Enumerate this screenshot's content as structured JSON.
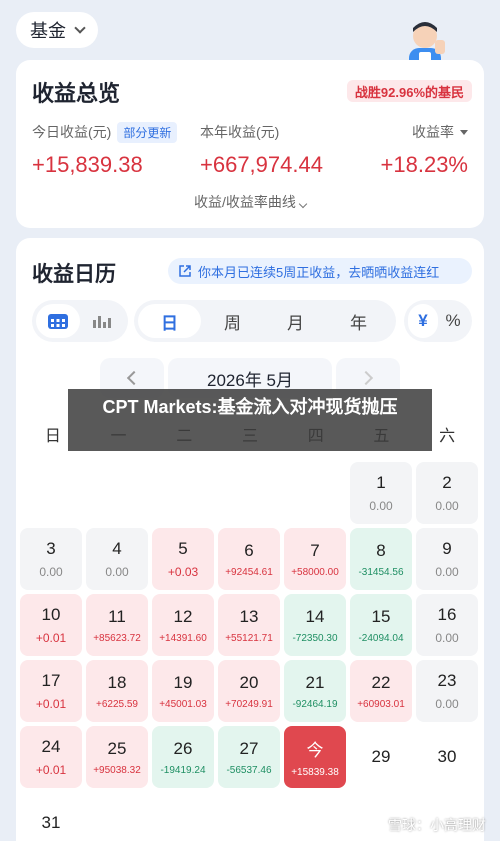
{
  "fund_selector": {
    "label": "基金"
  },
  "overview": {
    "title": "收益总览",
    "win_rate": "战胜92.96%的基民",
    "today": {
      "label": "今日收益(元)",
      "tag": "部分更新",
      "value": "+15,839.38"
    },
    "year": {
      "label": "本年收益(元)",
      "value": "+667,974.44"
    },
    "rate": {
      "label": "收益率",
      "value": "+18.23%"
    },
    "curve_link": "收益/收益率曲线"
  },
  "calendar": {
    "title": "收益日历",
    "streak_banner": "你本月已连续5周正收益，去晒晒收益连红",
    "period_tabs": [
      "日",
      "周",
      "月",
      "年"
    ],
    "unit_tabs": [
      "¥",
      "%"
    ],
    "month": "2026年 5月",
    "weekdays": [
      "日",
      "一",
      "二",
      "三",
      "四",
      "五",
      "六"
    ],
    "days": [
      {
        "d": "1",
        "v": "0.00"
      },
      {
        "d": "2",
        "v": "0.00"
      },
      {
        "d": "3",
        "v": "0.00"
      },
      {
        "d": "4",
        "v": "0.00"
      },
      {
        "d": "5",
        "v": "+0.03"
      },
      {
        "d": "6",
        "v": "+92454.61"
      },
      {
        "d": "7",
        "v": "+58000.00"
      },
      {
        "d": "8",
        "v": "-31454.56"
      },
      {
        "d": "9",
        "v": "0.00"
      },
      {
        "d": "10",
        "v": "+0.01"
      },
      {
        "d": "11",
        "v": "+85623.72"
      },
      {
        "d": "12",
        "v": "+14391.60"
      },
      {
        "d": "13",
        "v": "+55121.71"
      },
      {
        "d": "14",
        "v": "-72350.30"
      },
      {
        "d": "15",
        "v": "-24094.04"
      },
      {
        "d": "16",
        "v": "0.00"
      },
      {
        "d": "17",
        "v": "+0.01"
      },
      {
        "d": "18",
        "v": "+6225.59"
      },
      {
        "d": "19",
        "v": "+45001.03"
      },
      {
        "d": "20",
        "v": "+70249.91"
      },
      {
        "d": "21",
        "v": "-92464.19"
      },
      {
        "d": "22",
        "v": "+60903.01"
      },
      {
        "d": "23",
        "v": "0.00"
      },
      {
        "d": "24",
        "v": "+0.01"
      },
      {
        "d": "25",
        "v": "+95038.32"
      },
      {
        "d": "26",
        "v": "-19419.24"
      },
      {
        "d": "27",
        "v": "-56537.46"
      },
      {
        "d": "今",
        "v": "+15839.38"
      },
      {
        "d": "29",
        "v": ""
      },
      {
        "d": "30",
        "v": ""
      },
      {
        "d": "31",
        "v": ""
      }
    ]
  },
  "overlay_caption": "CPT Markets:基金流入对冲现货抛压",
  "watermark": "雪球：小高理财",
  "colors": {
    "positive": "#d8333f",
    "negative": "#1f8f63",
    "accent": "#2f6fe0",
    "today": "#e0484f"
  }
}
